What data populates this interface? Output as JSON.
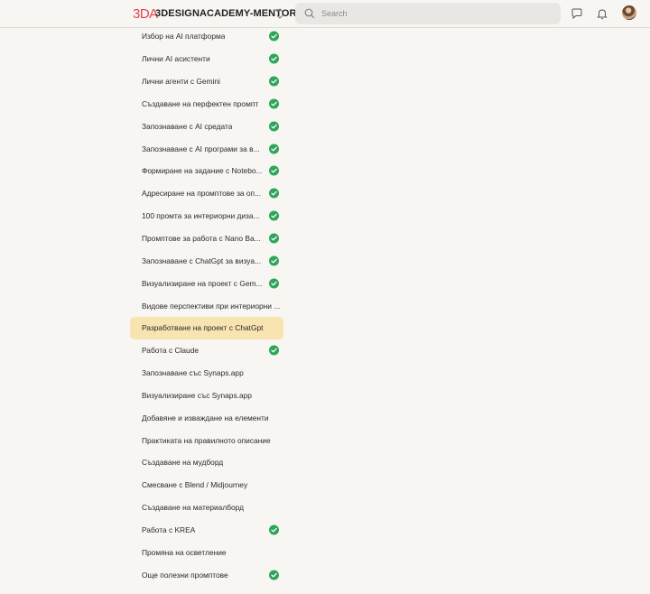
{
  "header": {
    "logo_text": "3DA",
    "brand_name": "3DESIGNACADEMY-MENTOR",
    "search_placeholder": "Search"
  },
  "colors": {
    "accent_logo": "#e0444f",
    "active_lesson_bg": "#f8e4b0",
    "check_green": "#2fa55a"
  },
  "lessons": [
    {
      "title": "Избор на AI платформа",
      "completed": true
    },
    {
      "title": "Лични AI асистенти",
      "completed": true
    },
    {
      "title": "Лични агенти с Gemini",
      "completed": true
    },
    {
      "title": "Създаване на перфектен промпт",
      "completed": true
    },
    {
      "title": "Запознаване с AI средата",
      "completed": true
    },
    {
      "title": "Запознаване с AI програми за в...",
      "completed": true
    },
    {
      "title": "Формиране на задание с Notebo...",
      "completed": true
    },
    {
      "title": "Адресиране на промптове за оп...",
      "completed": true
    },
    {
      "title": "100 промта за интериорни диза...",
      "completed": true
    },
    {
      "title": "Промптове за работа с Nano Ba...",
      "completed": true
    },
    {
      "title": "Запознаване с ChatGpt за визуа...",
      "completed": true
    },
    {
      "title": "Визуализиране на проект с Gem...",
      "completed": true
    },
    {
      "title": "Видове перспективи при интериорни ...",
      "completed": false
    },
    {
      "title": "Разработване на проект с ChatGpt",
      "completed": false,
      "active": true
    },
    {
      "title": "Работа с Claude",
      "completed": true
    },
    {
      "title": "Запознаване със Synaps.app",
      "completed": false
    },
    {
      "title": "Визуализиране със Synaps.app",
      "completed": false
    },
    {
      "title": "Добавяне и изваждане на елементи",
      "completed": false
    },
    {
      "title": "Практиката на правилното описание",
      "completed": false
    },
    {
      "title": "Създаване на мудборд",
      "completed": false
    },
    {
      "title": "Смесване с Blend / Midjourney",
      "completed": false
    },
    {
      "title": "Създаване на материалборд",
      "completed": false
    },
    {
      "title": "Работа с KREA",
      "completed": true
    },
    {
      "title": "Промяна на осветление",
      "completed": false
    },
    {
      "title": "Още полезни промптове",
      "completed": true
    }
  ]
}
